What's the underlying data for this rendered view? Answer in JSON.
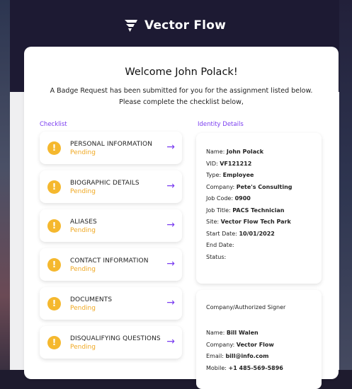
{
  "header": {
    "brand": "Vector Flow"
  },
  "main": {
    "welcome": "Welcome John Polack!",
    "intro_line1": "A Badge Request has been submitted for you for the assignment listed below.",
    "intro_line2": "Please complete the checklist below,",
    "checklist_label": "Checklist",
    "identity_label": "Identity Details"
  },
  "checklist": [
    {
      "title": "PERSONAL INFORMATION",
      "status": "Pending"
    },
    {
      "title": "BIOGRAPHIC DETAILS",
      "status": "Pending"
    },
    {
      "title": "ALIASES",
      "status": "Pending"
    },
    {
      "title": "CONTACT INFORMATION",
      "status": "Pending"
    },
    {
      "title": "DOCUMENTS",
      "status": "Pending"
    },
    {
      "title": "DISQUALIFYING QUESTIONS",
      "status": "Pending"
    }
  ],
  "identity": {
    "name_label": "Name:",
    "name": "John Polack",
    "vid_label": "VID:",
    "vid": "VF121212",
    "type_label": "Type:",
    "type": "Employee",
    "company_label": "Company:",
    "company": "Pete's Consulting",
    "job_code_label": "Job Code:",
    "job_code": "0900",
    "job_title_label": "Job Title:",
    "job_title": "PACS Technician",
    "site_label": "Site:",
    "site": "Vector Flow Tech Park",
    "start_label": "Start Date:",
    "start": "10/01/2022",
    "end_label": "End Date:",
    "status_label": "Status:"
  },
  "signer": {
    "heading": "Company/Authorized Signer",
    "name_label": "Name:",
    "name": "Bill Walen",
    "company_label": "Company:",
    "company": "Vector Flow",
    "email_label": "Email:",
    "email": "bill@info.com",
    "mobile_label": "Mobile:",
    "mobile": "+1 485-569-5896"
  },
  "colors": {
    "accent": "#7a3df0",
    "pending": "#f0a822",
    "warn": "#f5b82e",
    "header_bg": "#1d1a33"
  },
  "icons": {
    "warn": "!",
    "arrow": "→"
  }
}
